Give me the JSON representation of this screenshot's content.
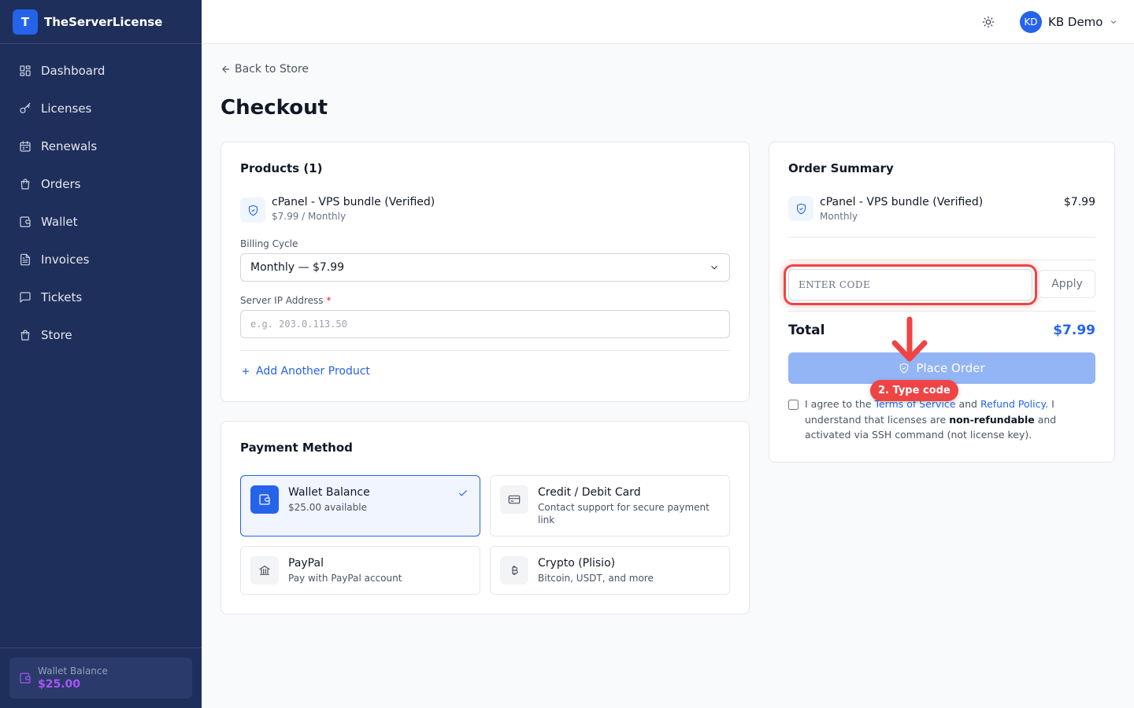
{
  "brand": {
    "logo_letter": "T",
    "name": "TheServerLicense"
  },
  "sidebar": {
    "items": [
      {
        "label": "Dashboard",
        "icon": "dashboard-icon"
      },
      {
        "label": "Licenses",
        "icon": "key-icon"
      },
      {
        "label": "Renewals",
        "icon": "calendar-icon"
      },
      {
        "label": "Orders",
        "icon": "bag-icon"
      },
      {
        "label": "Wallet",
        "icon": "wallet-icon"
      },
      {
        "label": "Invoices",
        "icon": "document-icon"
      },
      {
        "label": "Tickets",
        "icon": "chat-icon"
      },
      {
        "label": "Store",
        "icon": "store-icon"
      }
    ],
    "wallet": {
      "label": "Wallet Balance",
      "amount": "$25.00"
    }
  },
  "header": {
    "user_initials": "KD",
    "user_name": "KB Demo"
  },
  "page": {
    "back_label": "Back to Store",
    "title": "Checkout"
  },
  "products": {
    "title": "Products (1)",
    "item": {
      "name": "cPanel - VPS bundle (Verified)",
      "price": "$7.99 / Monthly"
    },
    "billing_label": "Billing Cycle",
    "billing_value": "Monthly — $7.99",
    "ip_label": "Server IP Address",
    "ip_required": "*",
    "ip_placeholder": "e.g. 203.0.113.50",
    "add_label": "Add Another Product"
  },
  "payment": {
    "title": "Payment Method",
    "methods": [
      {
        "name": "Wallet Balance",
        "desc": "$25.00 available",
        "selected": true
      },
      {
        "name": "Credit / Debit Card",
        "desc": "Contact support for secure payment link"
      },
      {
        "name": "PayPal",
        "desc": "Pay with PayPal account"
      },
      {
        "name": "Crypto (Plisio)",
        "desc": "Bitcoin, USDT, and more"
      }
    ]
  },
  "summary": {
    "title": "Order Summary",
    "item": {
      "name": "cPanel - VPS bundle (Verified)",
      "cycle": "Monthly",
      "price": "$7.99"
    },
    "coupon_placeholder": "ENTER CODE",
    "apply_label": "Apply",
    "total_label": "Total",
    "total_value": "$7.99",
    "place_label": "Place Order",
    "agree": {
      "part1": "I agree to the ",
      "tos": "Terms of Service",
      "and": " and ",
      "refund": "Refund Policy",
      "part2": ". I understand that licenses are ",
      "nonref": "non-refundable",
      "part3": " and activated via SSH command (not license key)."
    }
  },
  "tutorial": {
    "hint": "2. Type code",
    "color": "#ef4444"
  },
  "colors": {
    "sidebar_bg": "#1f2f5c",
    "accent": "#2563eb",
    "wallet_accent": "#a855f7"
  }
}
